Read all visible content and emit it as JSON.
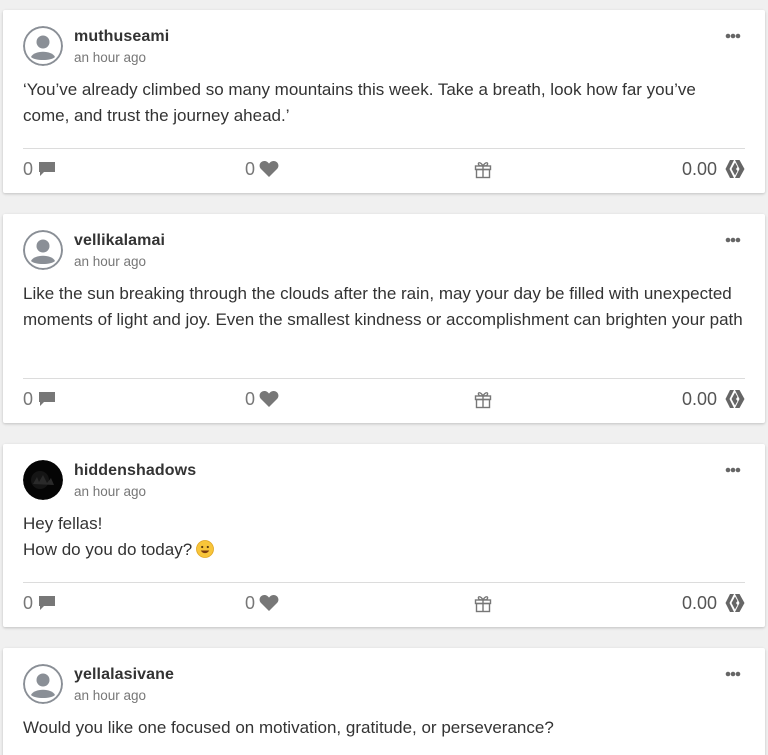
{
  "theme": {
    "icon_color": "#777777",
    "text_color": "#333333",
    "muted_color": "#777777",
    "background": "#f0f0f0",
    "card": "#ffffff"
  },
  "posts": [
    {
      "author": "muthuseami",
      "time": "an hour ago",
      "avatar": "default-avatar",
      "body_lines": [
        "‘You’ve already climbed so many mountains this week. Take a breath, look how far you’ve come, and trust the journey ahead.’"
      ],
      "comments": "0",
      "likes": "0",
      "payout": "0.00"
    },
    {
      "author": "vellikalamai",
      "time": "an hour ago",
      "avatar": "default-avatar",
      "body_lines": [
        "Like the sun breaking through the clouds after the rain, may your day be filled with unexpected moments of light and joy. Even the smallest kindness or accomplishment can brighten your path"
      ],
      "comments": "0",
      "likes": "0",
      "payout": "0.00"
    },
    {
      "author": "hiddenshadows",
      "time": "an hour ago",
      "avatar": "dark-photo-avatar",
      "body_lines": [
        "Hey fellas!",
        "How do you do today?"
      ],
      "emoji": "smiling-face-emoji",
      "comments": "0",
      "likes": "0",
      "payout": "0.00"
    },
    {
      "author": "yellalasivane",
      "time": "an hour ago",
      "avatar": "default-avatar",
      "body_lines": [
        "Would you like one focused on motivation, gratitude, or perseverance?"
      ]
    }
  ],
  "icons": {
    "comment": "comment-icon",
    "like": "heart-icon",
    "gift": "gift-icon",
    "payout": "hive-currency-icon",
    "menu": "more-dots-icon"
  }
}
